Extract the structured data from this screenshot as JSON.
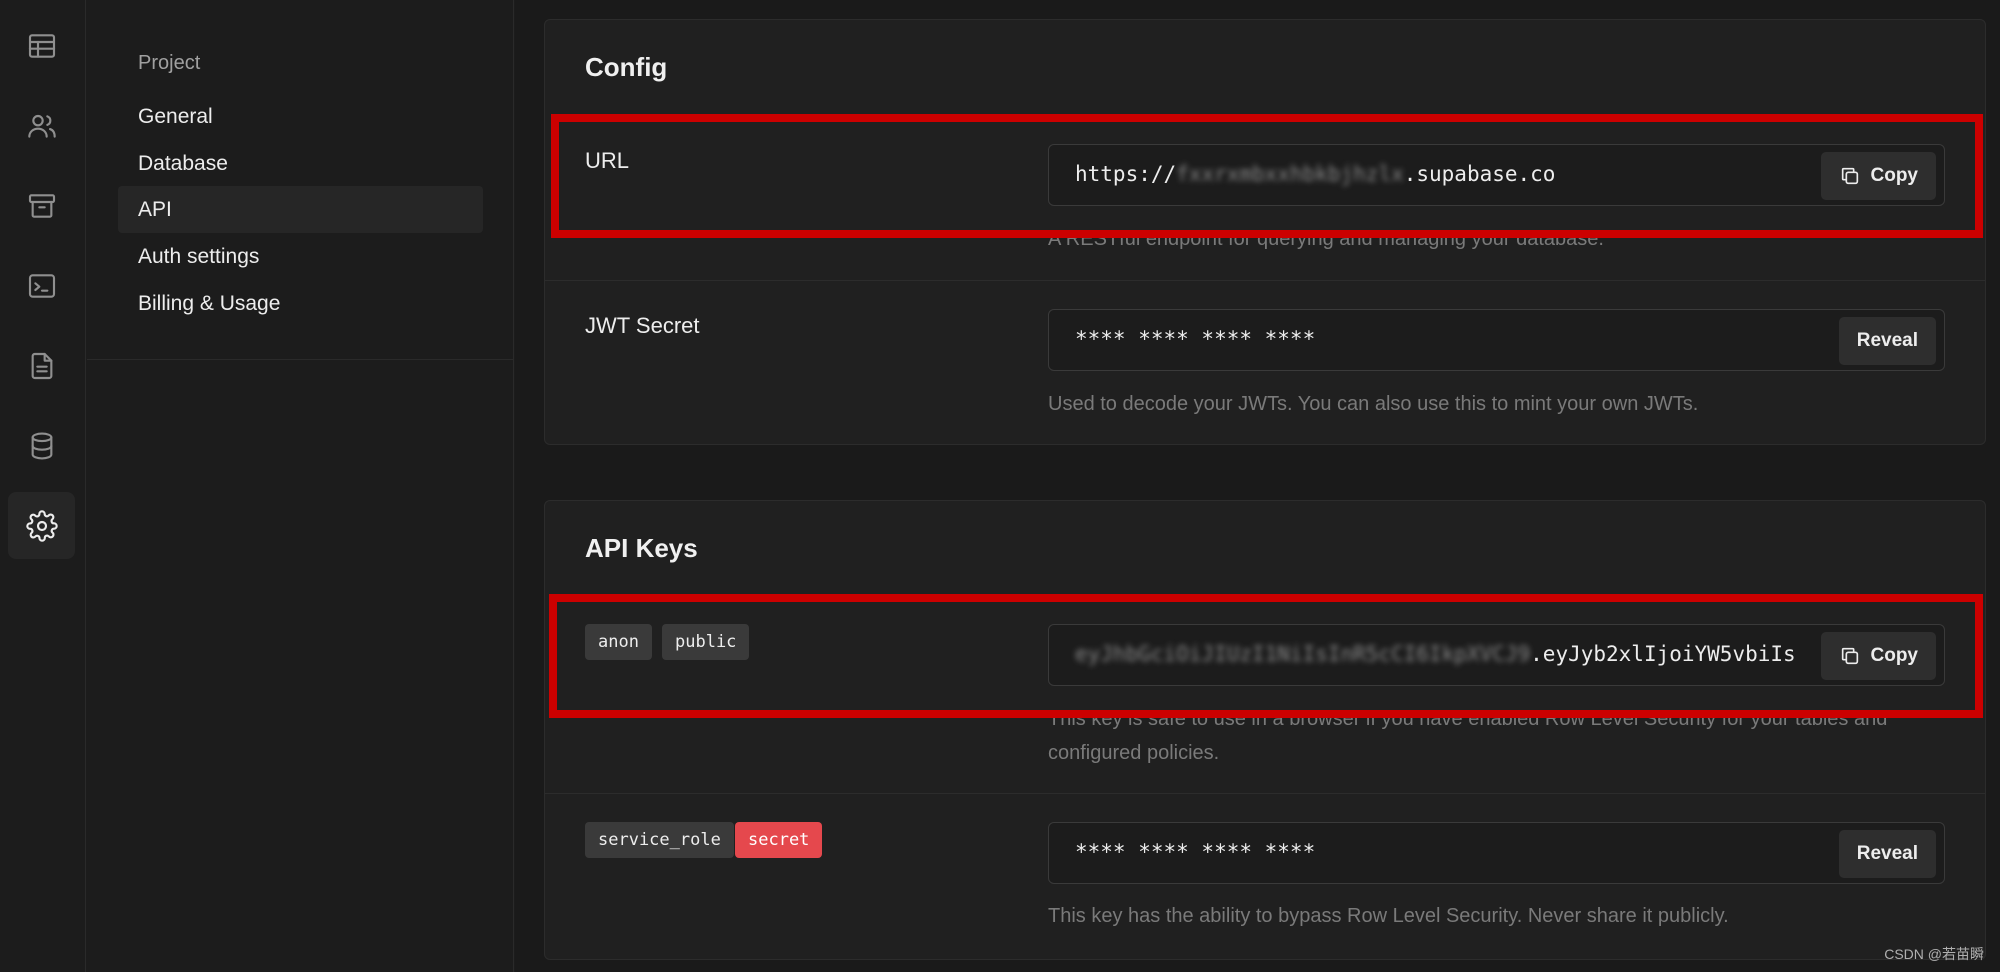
{
  "rail": {
    "items": [
      {
        "icon": "table-icon"
      },
      {
        "icon": "users-icon"
      },
      {
        "icon": "archive-icon"
      },
      {
        "icon": "terminal-icon"
      },
      {
        "icon": "document-icon"
      },
      {
        "icon": "database-icon"
      },
      {
        "icon": "gear-icon",
        "active": true
      }
    ]
  },
  "sidebar": {
    "heading": "Project",
    "items": [
      {
        "label": "General"
      },
      {
        "label": "Database"
      },
      {
        "label": "API",
        "active": true
      },
      {
        "label": "Auth settings"
      },
      {
        "label": "Billing & Usage"
      }
    ]
  },
  "config": {
    "title": "Config",
    "url": {
      "label": "URL",
      "prefix": "https://",
      "blurred": "fxxrxmbxxhbkbjhzlx",
      "suffix": ".supabase.co",
      "button": "Copy",
      "hint": "A RESTful endpoint for querying and managing your database."
    },
    "jwt": {
      "label": "JWT Secret",
      "value": "**** **** **** ****",
      "button": "Reveal",
      "hint": "Used to decode your JWTs. You can also use this to mint your own JWTs."
    }
  },
  "api_keys": {
    "title": "API Keys",
    "anon": {
      "tags": [
        "anon",
        "public"
      ],
      "blurred": "eyJhbGciOiJIUzI1NiIsInR5cCI6IkpXVCJ9",
      "visible": ".eyJyb2xlIjoiYW5vbiIs",
      "button": "Copy",
      "hint": "This key is safe to use in a browser if you have enabled Row Level Security for your tables and configured policies."
    },
    "service": {
      "tags": [
        "service_role",
        "secret"
      ],
      "value": "**** **** **** ****",
      "button": "Reveal",
      "hint": "This key has the ability to bypass Row Level Security. Never share it publicly."
    }
  },
  "colors": {
    "highlight": "#cc0000",
    "danger_tag": "#e5484d"
  },
  "watermark": "CSDN @若苗瞬"
}
